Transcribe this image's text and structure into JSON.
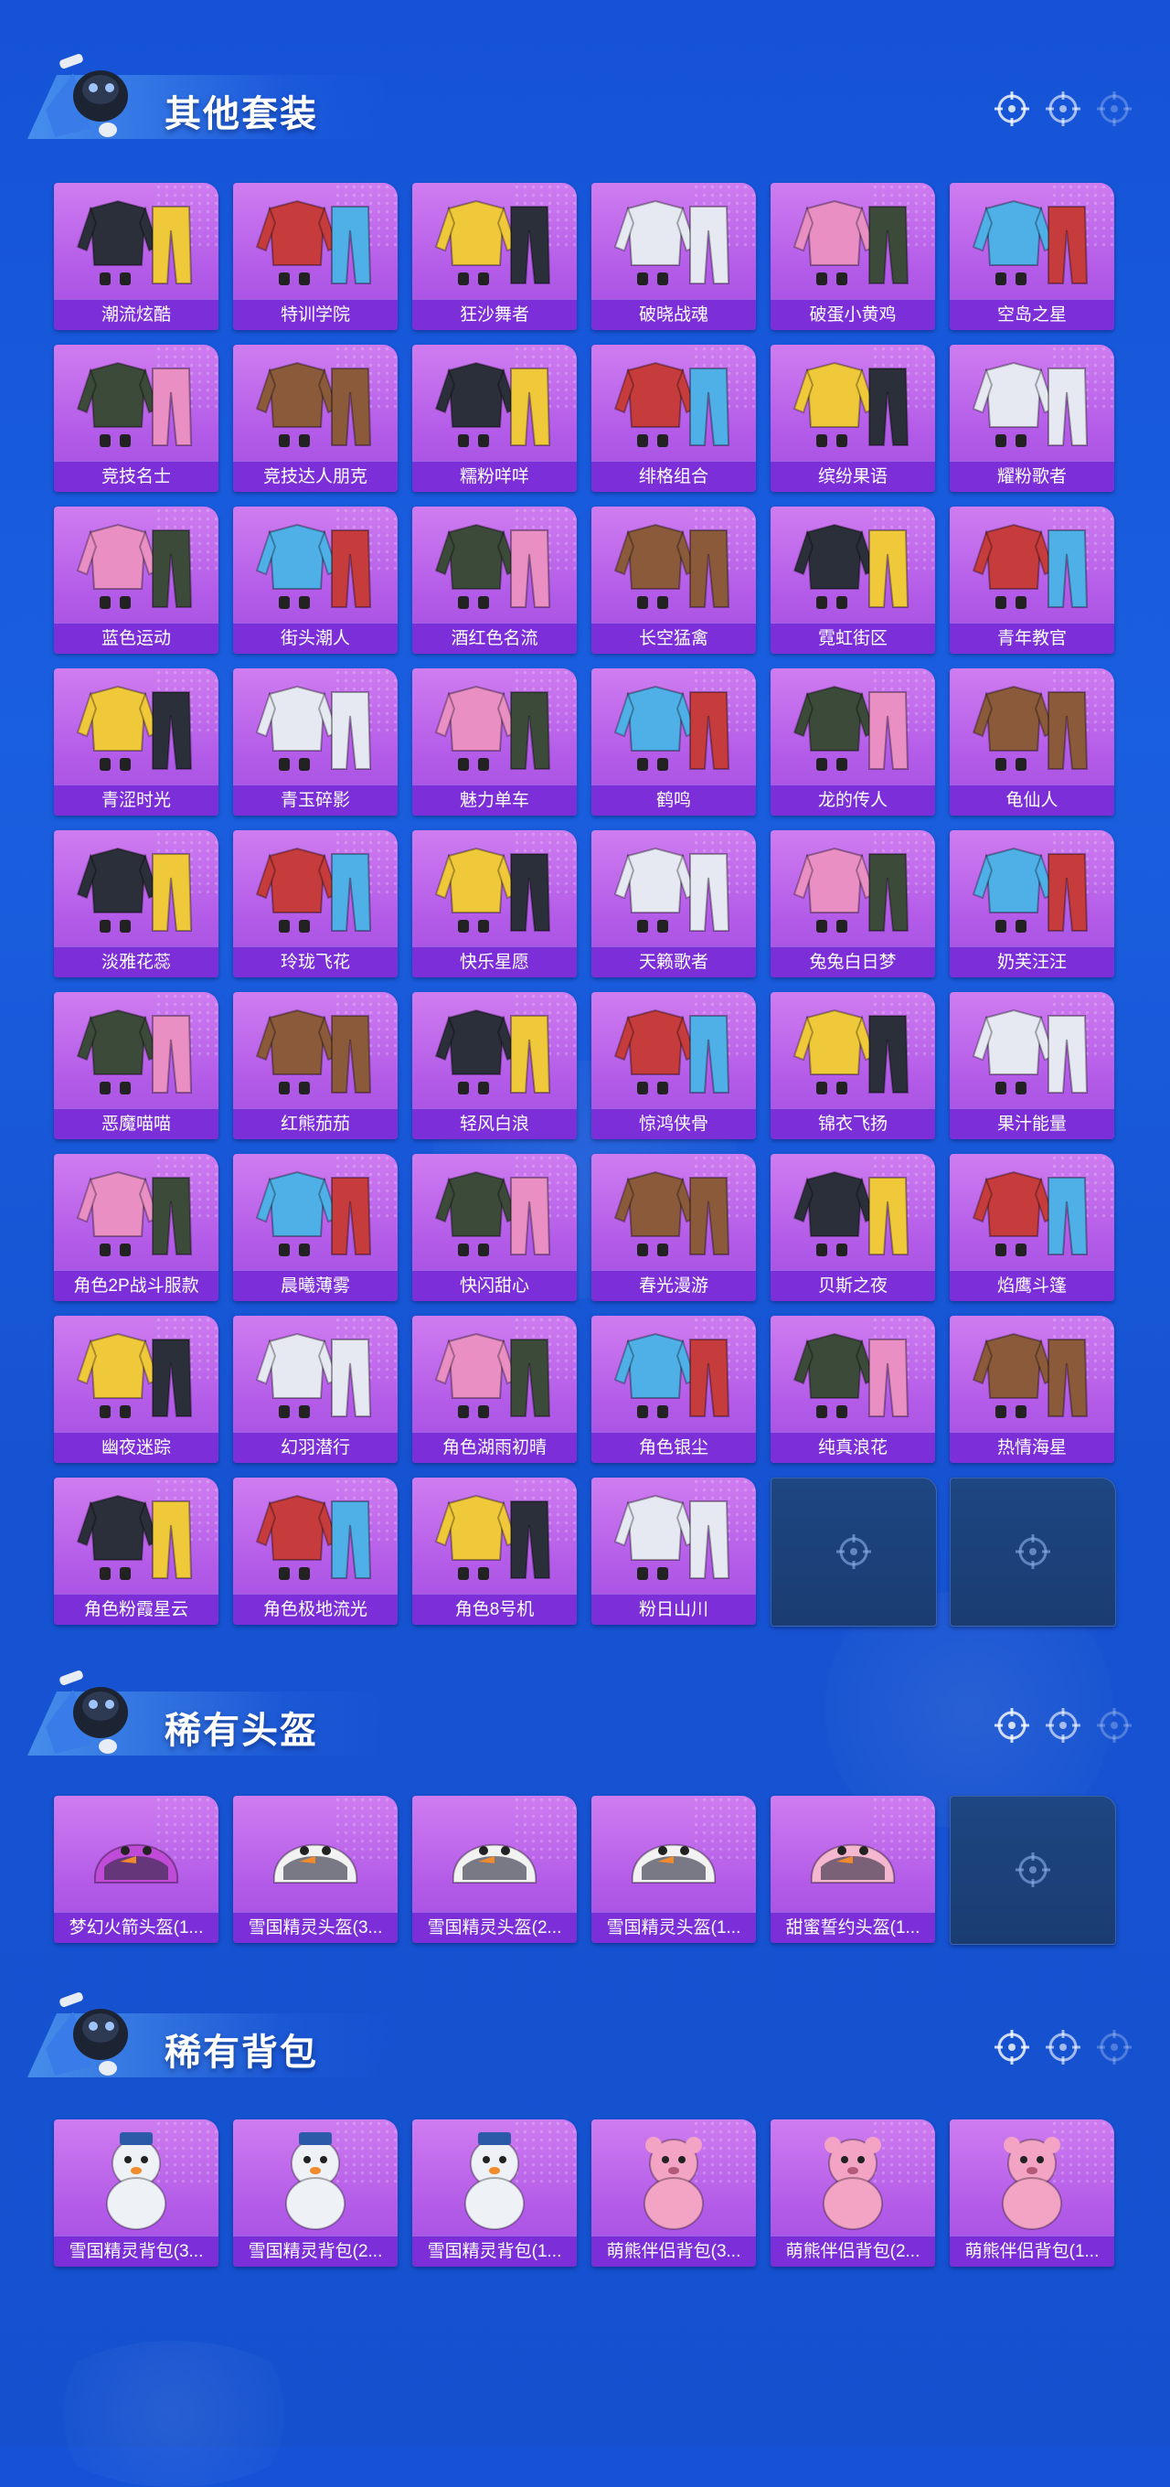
{
  "sections": [
    {
      "title": "其他套装",
      "items": [
        {
          "label": "潮流炫酷",
          "icon": "outfit-icon"
        },
        {
          "label": "特训学院",
          "icon": "outfit-icon"
        },
        {
          "label": "狂沙舞者",
          "icon": "outfit-icon"
        },
        {
          "label": "破晓战魂",
          "icon": "outfit-icon"
        },
        {
          "label": "破蛋小黄鸡",
          "icon": "outfit-icon"
        },
        {
          "label": "空岛之星",
          "icon": "outfit-icon"
        },
        {
          "label": "竞技名士",
          "icon": "outfit-icon"
        },
        {
          "label": "竞技达人朋克",
          "icon": "outfit-icon"
        },
        {
          "label": "糯粉咩咩",
          "icon": "outfit-icon"
        },
        {
          "label": "绯格组合",
          "icon": "outfit-icon"
        },
        {
          "label": "缤纷果语",
          "icon": "outfit-icon"
        },
        {
          "label": "耀粉歌者",
          "icon": "outfit-icon"
        },
        {
          "label": "蓝色运动",
          "icon": "outfit-icon"
        },
        {
          "label": "街头潮人",
          "icon": "outfit-icon"
        },
        {
          "label": "酒红色名流",
          "icon": "outfit-icon"
        },
        {
          "label": "长空猛禽",
          "icon": "outfit-icon"
        },
        {
          "label": "霓虹街区",
          "icon": "outfit-icon"
        },
        {
          "label": "青年教官",
          "icon": "outfit-icon"
        },
        {
          "label": "青涩时光",
          "icon": "outfit-icon"
        },
        {
          "label": "青玉碎影",
          "icon": "outfit-icon"
        },
        {
          "label": "魅力单车",
          "icon": "outfit-icon"
        },
        {
          "label": "鹤鸣",
          "icon": "outfit-icon"
        },
        {
          "label": "龙的传人",
          "icon": "outfit-icon"
        },
        {
          "label": "龟仙人",
          "icon": "outfit-icon"
        },
        {
          "label": "淡雅花蕊",
          "icon": "outfit-icon"
        },
        {
          "label": "玲珑飞花",
          "icon": "outfit-icon"
        },
        {
          "label": "快乐星愿",
          "icon": "outfit-icon"
        },
        {
          "label": "天籁歌者",
          "icon": "outfit-icon"
        },
        {
          "label": "兔兔白日梦",
          "icon": "outfit-icon"
        },
        {
          "label": "奶芙汪汪",
          "icon": "outfit-icon"
        },
        {
          "label": "恶魔喵喵",
          "icon": "outfit-icon"
        },
        {
          "label": "红熊茄茄",
          "icon": "outfit-icon"
        },
        {
          "label": "轻风白浪",
          "icon": "outfit-icon"
        },
        {
          "label": "惊鸿侠骨",
          "icon": "outfit-icon"
        },
        {
          "label": "锦衣飞扬",
          "icon": "outfit-icon"
        },
        {
          "label": "果汁能量",
          "icon": "outfit-icon"
        },
        {
          "label": "角色2P战斗服款",
          "icon": "outfit-icon"
        },
        {
          "label": "晨曦薄雾",
          "icon": "outfit-icon"
        },
        {
          "label": "快闪甜心",
          "icon": "outfit-icon"
        },
        {
          "label": "春光漫游",
          "icon": "outfit-icon"
        },
        {
          "label": "贝斯之夜",
          "icon": "outfit-icon"
        },
        {
          "label": "焰鹰斗篷",
          "icon": "outfit-icon"
        },
        {
          "label": "幽夜迷踪",
          "icon": "outfit-icon"
        },
        {
          "label": "幻羽潜行",
          "icon": "outfit-icon"
        },
        {
          "label": "角色湖雨初晴",
          "icon": "outfit-icon"
        },
        {
          "label": "角色银尘",
          "icon": "outfit-icon"
        },
        {
          "label": "纯真浪花",
          "icon": "outfit-icon"
        },
        {
          "label": "热情海星",
          "icon": "outfit-icon"
        },
        {
          "label": "角色粉霞星云",
          "icon": "outfit-icon"
        },
        {
          "label": "角色极地流光",
          "icon": "outfit-icon"
        },
        {
          "label": "角色8号机",
          "icon": "outfit-icon"
        },
        {
          "label": "粉日山川",
          "icon": "outfit-icon"
        }
      ],
      "empty_slots": 2
    },
    {
      "title": "稀有头盔",
      "items": [
        {
          "label": "梦幻火箭头盔(1...",
          "icon": "helmet-icon"
        },
        {
          "label": "雪国精灵头盔(3...",
          "icon": "helmet-icon"
        },
        {
          "label": "雪国精灵头盔(2...",
          "icon": "helmet-icon"
        },
        {
          "label": "雪国精灵头盔(1...",
          "icon": "helmet-icon"
        },
        {
          "label": "甜蜜誓约头盔(1...",
          "icon": "helmet-icon"
        }
      ],
      "empty_slots": 1
    },
    {
      "title": "稀有背包",
      "items": [
        {
          "label": "雪国精灵背包(3...",
          "icon": "backpack-icon"
        },
        {
          "label": "雪国精灵背包(2...",
          "icon": "backpack-icon"
        },
        {
          "label": "雪国精灵背包(1...",
          "icon": "backpack-icon"
        },
        {
          "label": "萌熊伴侣背包(3...",
          "icon": "backpack-icon"
        },
        {
          "label": "萌熊伴侣背包(2...",
          "icon": "backpack-icon"
        },
        {
          "label": "萌熊伴侣背包(1...",
          "icon": "backpack-icon"
        }
      ],
      "empty_slots": 0
    }
  ],
  "colors": {
    "background": "#1658d8",
    "card_gradient_top": "#cf7cf0",
    "card_label_bg": "#7c2ed8",
    "empty_slot_bg": "#1e4682"
  }
}
